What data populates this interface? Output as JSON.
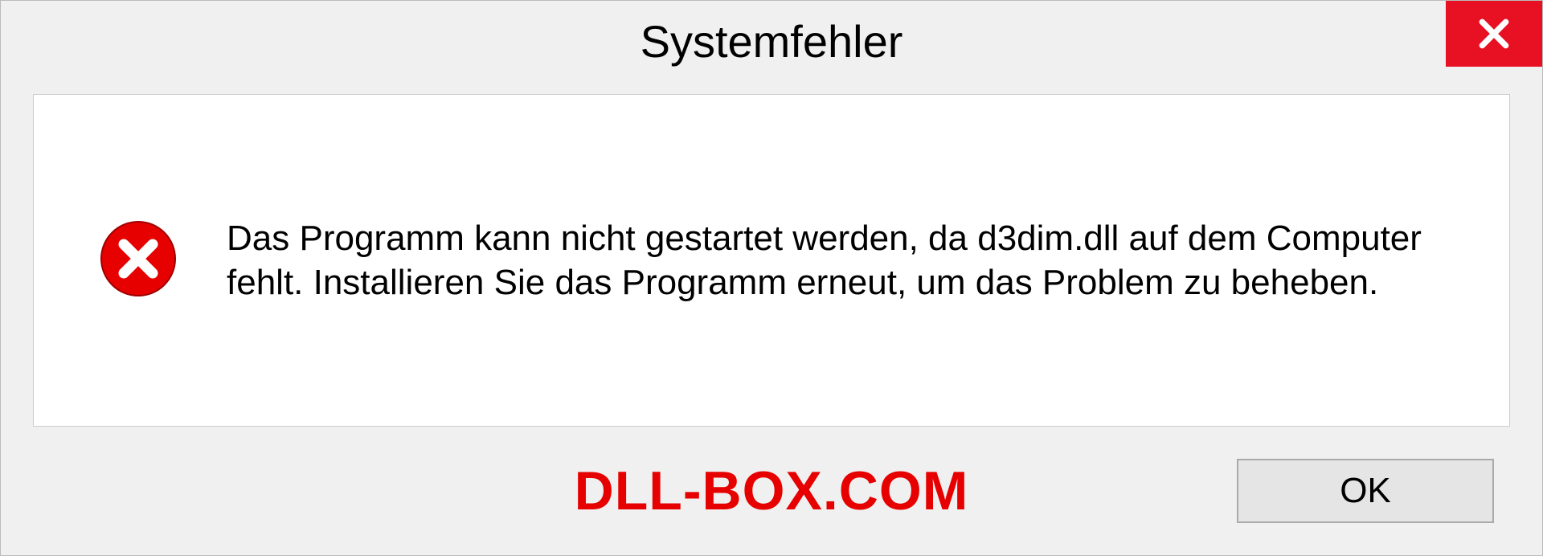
{
  "dialog": {
    "title": "Systemfehler",
    "message": "Das Programm kann nicht gestartet werden, da d3dim.dll auf dem Computer fehlt. Installieren Sie das Programm erneut, um das Problem zu beheben.",
    "ok_label": "OK"
  },
  "watermark": "DLL-BOX.COM",
  "colors": {
    "close_bg": "#e81123",
    "error_icon": "#e60000",
    "watermark": "#e60000"
  }
}
